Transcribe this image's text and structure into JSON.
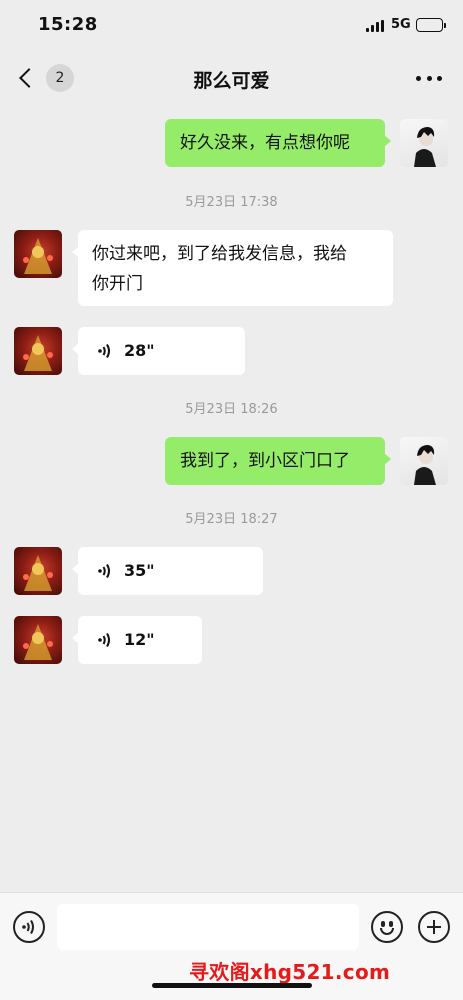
{
  "status_bar": {
    "time": "15:28",
    "network": "5G"
  },
  "nav": {
    "unread_count": "2",
    "title": "那么可爱"
  },
  "messages": [
    {
      "sender": "self",
      "type": "text",
      "text": "好久没来，有点想你呢"
    },
    {
      "type": "timestamp",
      "text": "5月23日 17:38"
    },
    {
      "sender": "other",
      "type": "text",
      "text_line1": "你过来吧，到了给我发信息，我给",
      "text_line2": "你开门"
    },
    {
      "sender": "other",
      "type": "voice",
      "duration": "28\""
    },
    {
      "type": "timestamp",
      "text": "5月23日 18:26"
    },
    {
      "sender": "self",
      "type": "text",
      "text": "我到了，到小区门口了"
    },
    {
      "type": "timestamp",
      "text": "5月23日 18:27"
    },
    {
      "sender": "other",
      "type": "voice",
      "duration": "35\""
    },
    {
      "sender": "other",
      "type": "voice",
      "duration": "12\""
    }
  ],
  "input_bar": {
    "value": ""
  },
  "watermark": "寻欢阁xhg521.com",
  "colors": {
    "self_bubble": "#95ec69",
    "other_bubble": "#ffffff",
    "background": "#ededed",
    "watermark": "#e31b1b"
  },
  "icons": {
    "back": "chevron-left-icon",
    "more": "ellipsis-icon",
    "voice": "voice-wave-icon",
    "emoji": "smiley-icon",
    "plus": "plus-circle-icon"
  }
}
